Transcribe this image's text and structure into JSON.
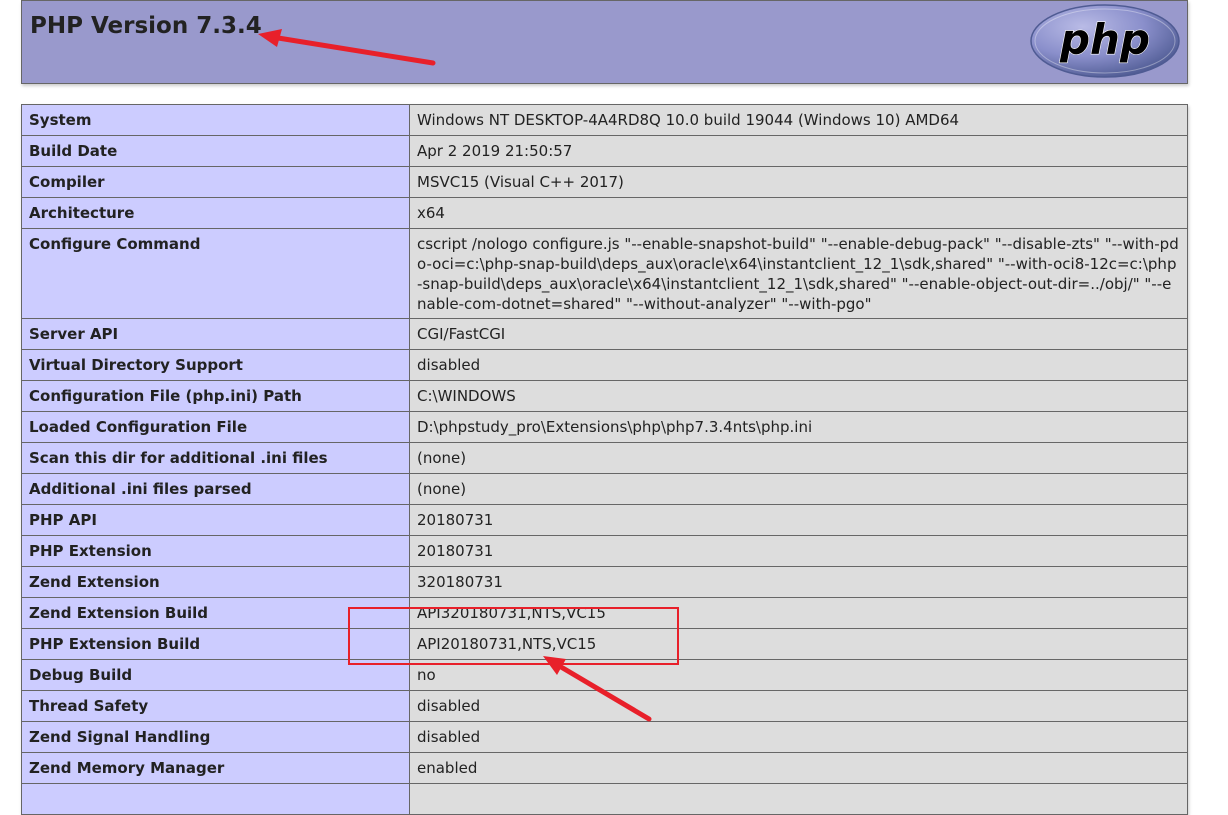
{
  "header": {
    "title": "PHP Version 7.3.4",
    "logo_text": "php"
  },
  "rows": [
    {
      "label": "System",
      "value": "Windows NT DESKTOP-4A4RD8Q 10.0 build 19044 (Windows 10) AMD64"
    },
    {
      "label": "Build Date",
      "value": "Apr 2 2019 21:50:57"
    },
    {
      "label": "Compiler",
      "value": "MSVC15 (Visual C++ 2017)"
    },
    {
      "label": "Architecture",
      "value": "x64"
    },
    {
      "label": "Configure Command",
      "value": "cscript /nologo configure.js \"--enable-snapshot-build\" \"--enable-debug-pack\" \"--disable-zts\" \"--with-pdo-oci=c:\\php-snap-build\\deps_aux\\oracle\\x64\\instantclient_12_1\\sdk,shared\" \"--with-oci8-12c=c:\\php-snap-build\\deps_aux\\oracle\\x64\\instantclient_12_1\\sdk,shared\" \"--enable-object-out-dir=../obj/\" \"--enable-com-dotnet=shared\" \"--without-analyzer\" \"--with-pgo\""
    },
    {
      "label": "Server API",
      "value": "CGI/FastCGI"
    },
    {
      "label": "Virtual Directory Support",
      "value": "disabled"
    },
    {
      "label": "Configuration File (php.ini) Path",
      "value": "C:\\WINDOWS"
    },
    {
      "label": "Loaded Configuration File",
      "value": "D:\\phpstudy_pro\\Extensions\\php\\php7.3.4nts\\php.ini"
    },
    {
      "label": "Scan this dir for additional .ini files",
      "value": "(none)"
    },
    {
      "label": "Additional .ini files parsed",
      "value": "(none)"
    },
    {
      "label": "PHP API",
      "value": "20180731"
    },
    {
      "label": "PHP Extension",
      "value": "20180731"
    },
    {
      "label": "Zend Extension",
      "value": "320180731"
    },
    {
      "label": "Zend Extension Build",
      "value": "API320180731,NTS,VC15"
    },
    {
      "label": "PHP Extension Build",
      "value": "API20180731,NTS,VC15"
    },
    {
      "label": "Debug Build",
      "value": "no"
    },
    {
      "label": "Thread Safety",
      "value": "disabled"
    },
    {
      "label": "Zend Signal Handling",
      "value": "disabled"
    },
    {
      "label": "Zend Memory Manager",
      "value": "enabled"
    },
    {
      "label": "",
      "value": ""
    }
  ],
  "colors": {
    "header_bg": "#9999cc",
    "label_bg": "#ccccff",
    "value_bg": "#dddddd",
    "annotation_red": "#e8202a"
  }
}
